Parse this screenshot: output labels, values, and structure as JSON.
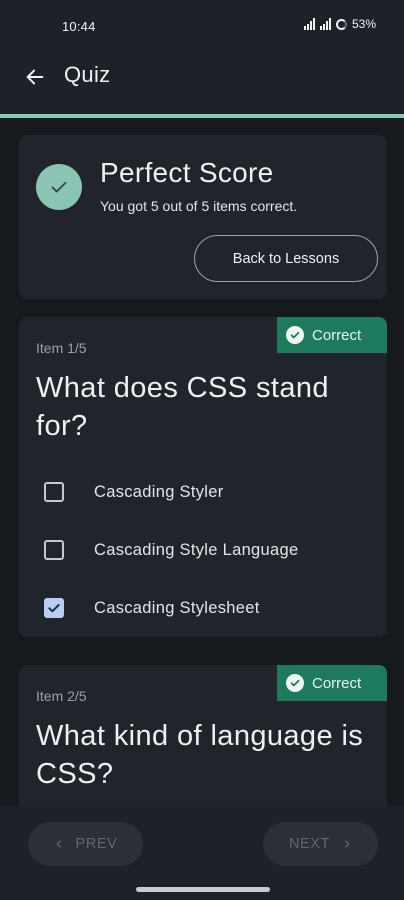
{
  "status_bar": {
    "time": "10:44",
    "battery": "53%"
  },
  "app_bar": {
    "title": "Quiz",
    "back_icon": "arrow-left-icon"
  },
  "colors": {
    "accent": "#8cc9ba",
    "correct_badge": "#1d7a5e",
    "checked_box": "#b9cdf5"
  },
  "summary": {
    "title": "Perfect Score",
    "subtitle": "You got 5 out of 5 items correct.",
    "button_label": "Back to Lessons"
  },
  "questions": [
    {
      "item_label": "Item 1/5",
      "badge": "Correct",
      "question": "What does CSS stand for?",
      "options": [
        {
          "label": "Cascading Styler",
          "checked": false
        },
        {
          "label": "Cascading Style Language",
          "checked": false
        },
        {
          "label": "Cascading Stylesheet",
          "checked": true
        }
      ]
    },
    {
      "item_label": "Item 2/5",
      "badge": "Correct",
      "question": "What kind of language is CSS?"
    }
  ],
  "navigation": {
    "prev_label": "PREV",
    "next_label": "NEXT"
  }
}
